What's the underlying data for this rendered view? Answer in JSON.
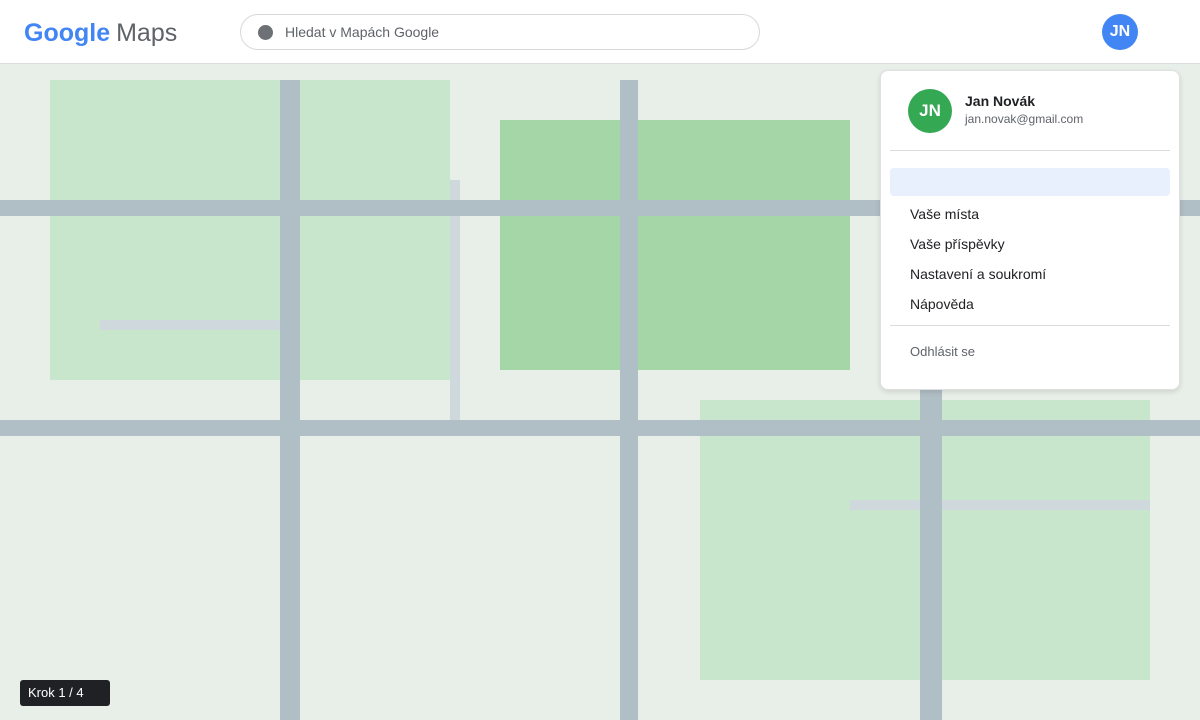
{
  "app": {
    "logo_google": "Google",
    "logo_maps": "Maps"
  },
  "search": {
    "placeholder": "Hledat v Mapách Google",
    "value": ""
  },
  "user": {
    "initials": "JN",
    "name": "Jan Novák",
    "email": "jan.novak@gmail.com"
  },
  "menu": {
    "highlighted_item": "",
    "items": [
      {
        "label": "Vaše místa"
      },
      {
        "label": "Vaše příspěvky"
      },
      {
        "label": "Nastavení a soukromí"
      },
      {
        "label": "Nápověda"
      }
    ],
    "signout_label": "Odhlásit se"
  },
  "step": {
    "label": "Krok 1 / 4"
  },
  "colors": {
    "brand_blue": "#4285f4",
    "avatar_green": "#34a853",
    "park_light": "#c8e6cc",
    "park_dark": "#a5d6a7",
    "road": "#b0bec5",
    "map_background": "#e8efe8"
  }
}
